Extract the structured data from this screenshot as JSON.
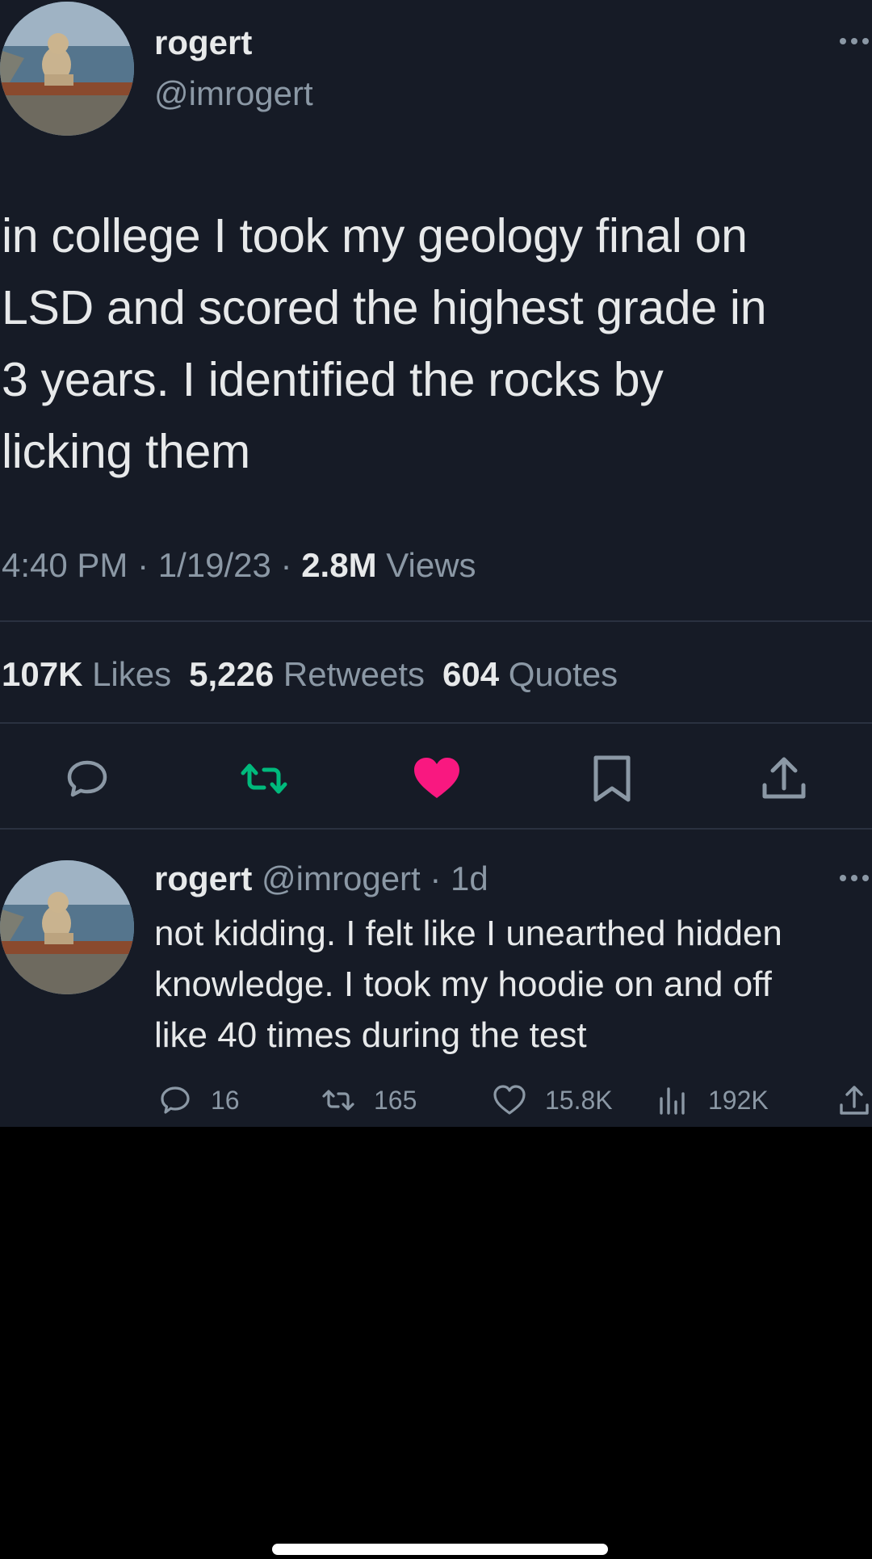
{
  "colors": {
    "background": "#161b26",
    "text_primary": "#e7e9ea",
    "text_secondary": "#8b98a5",
    "retweet_green": "#00ba7c",
    "like_pink": "#f91880",
    "divider": "#2a3140"
  },
  "tweet": {
    "author_name": "rogert",
    "author_handle": "@imrogert",
    "text": "in college I took my geology final on\nLSD and scored the highest grade in\n3 years. I identified the rocks by\nlicking them",
    "time": "4:40 PM · 1/19/23 · ",
    "views_count": "2.8M",
    "views_label": " Views",
    "likes_count": "107K",
    "likes_label": "Likes",
    "retweets_count": "5,226",
    "retweets_label": "Retweets",
    "quotes_count": "604",
    "quotes_label": "Quotes",
    "actions": {
      "reply": "reply-icon",
      "retweet": "retweet-icon",
      "like": "heart-icon",
      "bookmark": "bookmark-icon",
      "share": "share-icon"
    },
    "liked": true,
    "retweeted": true
  },
  "reply": {
    "author_name": "rogert",
    "author_handle_time": "@imrogert · 1d",
    "text": "not kidding. I felt like I unearthed hidden\nknowledge. I took my hoodie on and off\nlike 40 times during the test",
    "replies": "16",
    "retweets": "165",
    "likes": "15.8K",
    "views": "192K"
  }
}
